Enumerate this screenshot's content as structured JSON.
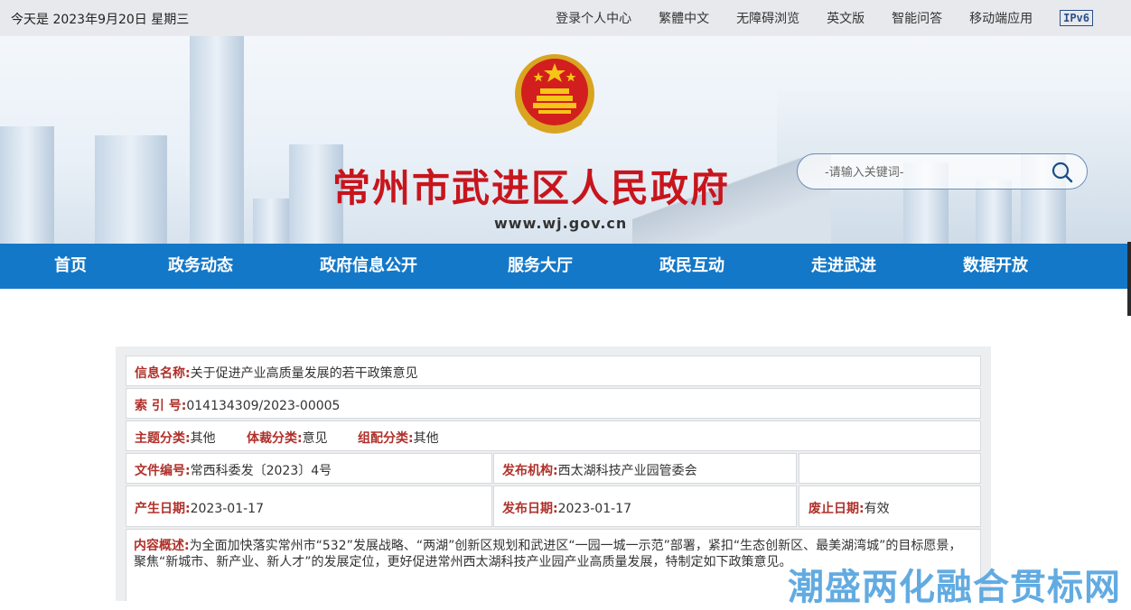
{
  "topbar": {
    "date": "今天是 2023年9月20日 星期三",
    "links": [
      "登录个人中心",
      "繁體中文",
      "无障碍浏览",
      "英文版",
      "智能问答",
      "移动端应用"
    ],
    "ipv6": "IPv6"
  },
  "header": {
    "title": "常州市武进区人民政府",
    "url": "www.wj.gov.cn",
    "search_placeholder": "-请输入关键词-"
  },
  "nav": {
    "items": [
      "首页",
      "政务动态",
      "政府信息公开",
      "服务大厅",
      "政民互动",
      "走进武进",
      "数据开放"
    ]
  },
  "info": {
    "name_label": "信息名称:",
    "name_value": "关于促进产业高质量发展的若干政策意见",
    "index_label": "索 引 号:",
    "index_value": "014134309/2023-00005",
    "topic_label": "主题分类:",
    "topic_value": "其他",
    "genre_label": "体裁分类:",
    "genre_value": "意见",
    "org_label": "组配分类:",
    "org_value": "其他",
    "docno_label": "文件编号:",
    "docno_value": "常西科委发〔2023〕4号",
    "publisher_label": "发布机构:",
    "publisher_value": "西太湖科技产业园管委会",
    "created_label": "产生日期:",
    "created_value": "2023-01-17",
    "published_label": "发布日期:",
    "published_value": "2023-01-17",
    "expire_label": "废止日期:",
    "expire_value": "有效",
    "summary_label": "内容概述:",
    "summary_value": "为全面加快落实常州市“532”发展战略、“两湖”创新区规划和武进区“一园一城一示范”部署，紧扣“生态创新区、最美湖湾城”的目标愿景，聚焦“新城市、新产业、新人才”的发展定位，更好促进常州西太湖科技产业园产业高质量发展，特制定如下政策意见。"
  },
  "watermark": "潮盛两化融合贯标网",
  "colors": {
    "nav": "#1478c8",
    "title": "#c8151d",
    "label": "#b0302a"
  }
}
